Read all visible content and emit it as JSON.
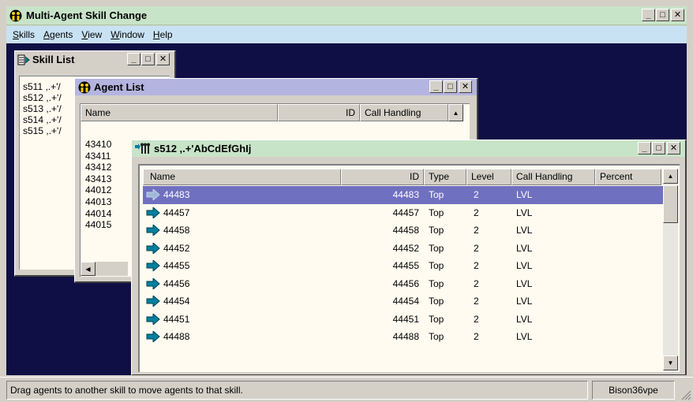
{
  "app": {
    "title": "Multi-Agent Skill Change"
  },
  "menu": {
    "items": [
      {
        "u": "S",
        "rest": "kills"
      },
      {
        "u": "A",
        "rest": "gents"
      },
      {
        "u": "V",
        "rest": "iew"
      },
      {
        "u": "W",
        "rest": "indow"
      },
      {
        "u": "H",
        "rest": "elp"
      }
    ]
  },
  "skill_list": {
    "title": "Skill List",
    "items": [
      "s511 ,.+'/",
      "s512 ,.+'/",
      "s513 ,.+'/",
      "s514 ,.+'/",
      "s515 ,.+'/"
    ]
  },
  "agent_list": {
    "title": "Agent List",
    "columns": {
      "name": "Name",
      "id": "ID",
      "call": "Call Handling"
    },
    "rows": [
      "43410",
      "43411",
      "43412",
      "43413",
      "44012",
      "44013",
      "44014",
      "44015"
    ]
  },
  "detail": {
    "title": "s512 ,.+'AbCdEfGhIj",
    "columns": {
      "name": "Name",
      "id": "ID",
      "type": "Type",
      "level": "Level",
      "call": "Call Handling",
      "percent": "Percent"
    },
    "rows": [
      {
        "name": "44483",
        "id": "44483",
        "type": "Top",
        "level": "2",
        "call": "LVL"
      },
      {
        "name": "44457",
        "id": "44457",
        "type": "Top",
        "level": "2",
        "call": "LVL"
      },
      {
        "name": "44458",
        "id": "44458",
        "type": "Top",
        "level": "2",
        "call": "LVL"
      },
      {
        "name": "44452",
        "id": "44452",
        "type": "Top",
        "level": "2",
        "call": "LVL"
      },
      {
        "name": "44455",
        "id": "44455",
        "type": "Top",
        "level": "2",
        "call": "LVL"
      },
      {
        "name": "44456",
        "id": "44456",
        "type": "Top",
        "level": "2",
        "call": "LVL"
      },
      {
        "name": "44454",
        "id": "44454",
        "type": "Top",
        "level": "2",
        "call": "LVL"
      },
      {
        "name": "44451",
        "id": "44451",
        "type": "Top",
        "level": "2",
        "call": "LVL"
      },
      {
        "name": "44488",
        "id": "44488",
        "type": "Top",
        "level": "2",
        "call": "LVL"
      }
    ]
  },
  "status": {
    "message": "Drag agents to another skill to move agents to that skill.",
    "user": "Bison36vpe"
  },
  "colors": {
    "mdi_bg": "#0f0f45",
    "app_title": "#c8e4c8",
    "menubar": "#c9e2f3",
    "selection": "#7070c0",
    "arrow": "#0080a0"
  }
}
